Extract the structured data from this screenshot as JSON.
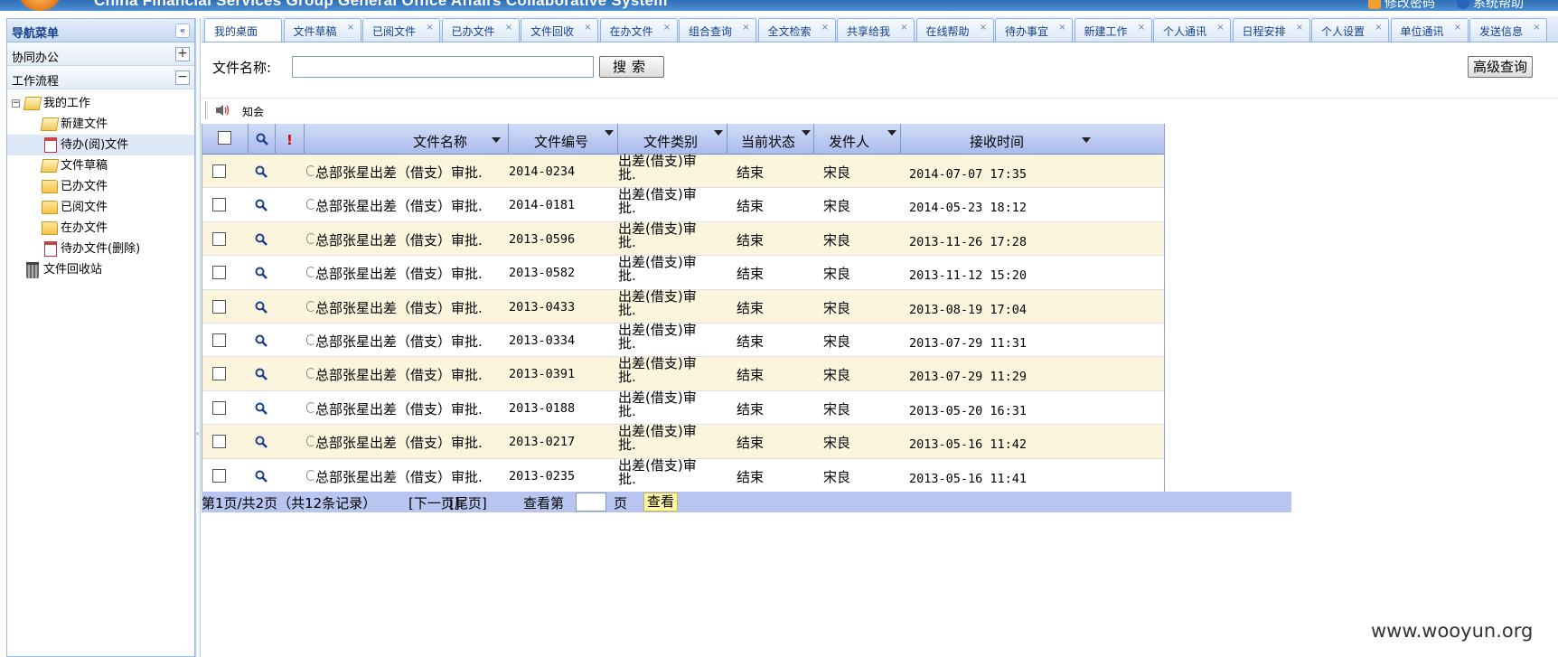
{
  "app": {
    "title": "China Financial Services Group General Office Affairs Collaborative System",
    "top_links": [
      "修改密码",
      "系统帮助"
    ]
  },
  "sidebar": {
    "header": "导航菜单",
    "collapse_icon": "«",
    "sections": [
      {
        "label": "协同办公",
        "toggle": "+"
      },
      {
        "label": "工作流程",
        "toggle": "−"
      }
    ],
    "tree": {
      "root": "我的工作",
      "items": [
        {
          "label": "新建文件",
          "icon": "folder-open-icon"
        },
        {
          "label": "待办(阅)文件",
          "icon": "clipboard-icon",
          "selected": true
        },
        {
          "label": "文件草稿",
          "icon": "folder-open-icon"
        },
        {
          "label": "已办文件",
          "icon": "folder-arrow-icon"
        },
        {
          "label": "已阅文件",
          "icon": "folder-icon"
        },
        {
          "label": "在办文件",
          "icon": "folder-icon"
        },
        {
          "label": "待办文件(删除)",
          "icon": "clipboard-icon"
        }
      ],
      "recycle": "文件回收站"
    }
  },
  "tabs": [
    "我的桌面",
    "文件草稿",
    "已阅文件",
    "已办文件",
    "文件回收",
    "在办文件",
    "组合查询",
    "全文检索",
    "共享给我",
    "在线帮助",
    "待办事宜",
    "新建工作",
    "个人通讯",
    "日程安排",
    "个人设置",
    "单位通讯",
    "发送信息"
  ],
  "search": {
    "label": "文件名称:",
    "value": "",
    "button": "搜索",
    "advanced": "高级查询"
  },
  "toolbar": {
    "label": "知会"
  },
  "grid": {
    "columns": [
      "文件名称",
      "文件编号",
      "文件类别",
      "当前状态",
      "发件人",
      "接收时间"
    ],
    "rows": [
      {
        "name": "总部张星出差（借支）审批.",
        "no": "2014-0234",
        "cat": "出差(借支)审批.",
        "status": "结束",
        "sender": "宋良",
        "time": "2014-07-07 17:35"
      },
      {
        "name": "总部张星出差（借支）审批.",
        "no": "2014-0181",
        "cat": "出差(借支)审批.",
        "status": "结束",
        "sender": "宋良",
        "time": "2014-05-23 18:12"
      },
      {
        "name": "总部张星出差（借支）审批.",
        "no": "2013-0596",
        "cat": "出差(借支)审批.",
        "status": "结束",
        "sender": "宋良",
        "time": "2013-11-26 17:28"
      },
      {
        "name": "总部张星出差（借支）审批.",
        "no": "2013-0582",
        "cat": "出差(借支)审批.",
        "status": "结束",
        "sender": "宋良",
        "time": "2013-11-12 15:20"
      },
      {
        "name": "总部张星出差（借支）审批.",
        "no": "2013-0433",
        "cat": "出差(借支)审批.",
        "status": "结束",
        "sender": "宋良",
        "time": "2013-08-19 17:04"
      },
      {
        "name": "总部张星出差（借支）审批.",
        "no": "2013-0334",
        "cat": "出差(借支)审批.",
        "status": "结束",
        "sender": "宋良",
        "time": "2013-07-29 11:31"
      },
      {
        "name": "总部张星出差（借支）审批.",
        "no": "2013-0391",
        "cat": "出差(借支)审批.",
        "status": "结束",
        "sender": "宋良",
        "time": "2013-07-29 11:29"
      },
      {
        "name": "总部张星出差（借支）审批.",
        "no": "2013-0188",
        "cat": "出差(借支)审批.",
        "status": "结束",
        "sender": "宋良",
        "time": "2013-05-20 16:31"
      },
      {
        "name": "总部张星出差（借支）审批.",
        "no": "2013-0217",
        "cat": "出差(借支)审批.",
        "status": "结束",
        "sender": "宋良",
        "time": "2013-05-16 11:42"
      },
      {
        "name": "总部张星出差（借支）审批.",
        "no": "2013-0235",
        "cat": "出差(借支)审批.",
        "status": "结束",
        "sender": "宋良",
        "time": "2013-05-16 11:41"
      }
    ]
  },
  "pager": {
    "info": "第1页/共2页（共12条记录）",
    "next": "[下一页]",
    "last": "[尾页]",
    "goto": "查看第",
    "page_unit": "页",
    "view": "查看"
  },
  "watermark": "www.wooyun.org",
  "colors": {
    "accent": "#15428b",
    "row_odd": "#fcf5de",
    "header": "#aabced",
    "pager": "#b7c5f0"
  }
}
